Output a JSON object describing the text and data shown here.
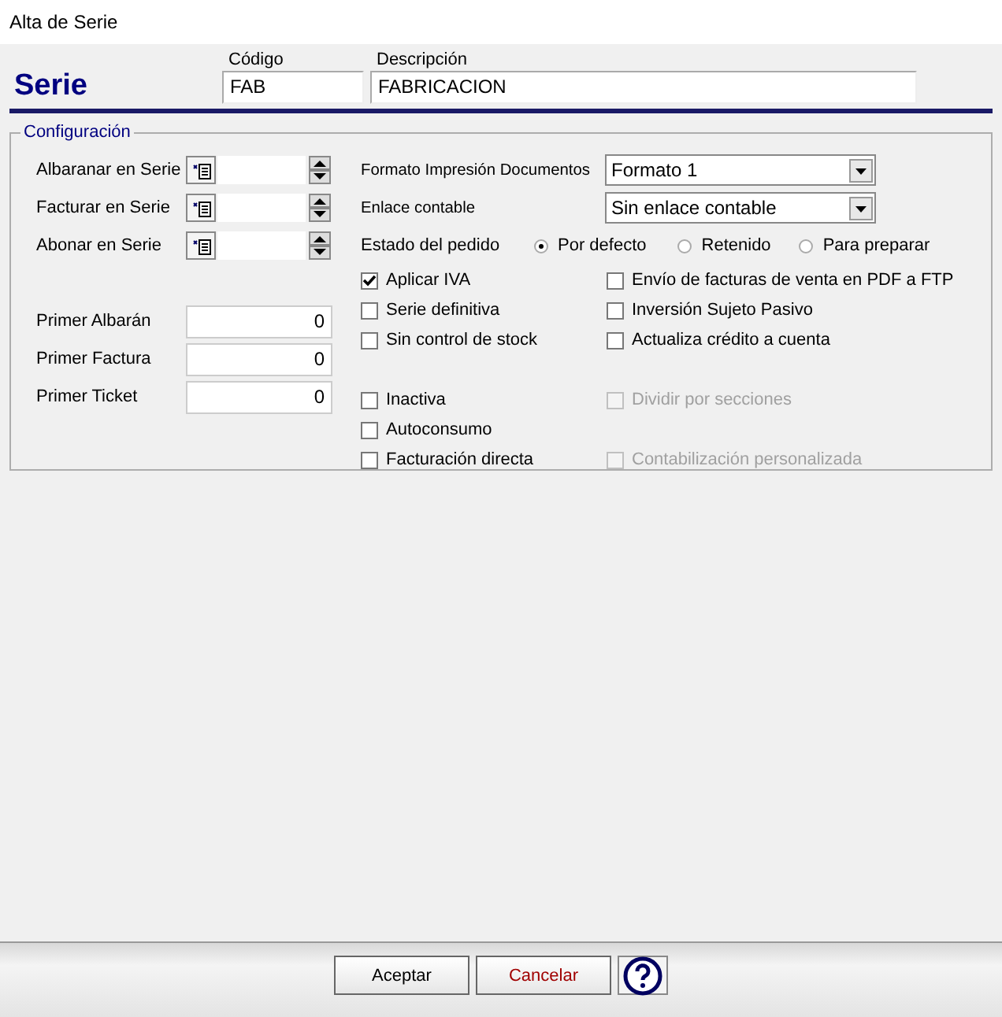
{
  "window": {
    "title": "Alta de Serie"
  },
  "header": {
    "title": "Serie",
    "fields": [
      {
        "label": "Código",
        "value": "FAB"
      },
      {
        "label": "Descripción",
        "value": "FABRICACION"
      }
    ]
  },
  "config": {
    "legend": "Configuración",
    "series_rows": [
      {
        "label": "Albaranar en Serie"
      },
      {
        "label": "Facturar en Serie"
      },
      {
        "label": "Abonar en Serie"
      }
    ],
    "counters": [
      {
        "label": "Primer Albarán",
        "value": "0"
      },
      {
        "label": "Primer Factura",
        "value": "0"
      },
      {
        "label": "Primer Ticket",
        "value": "0"
      }
    ],
    "selects": [
      {
        "label": "Formato Impresión Documentos",
        "value": "Formato 1"
      },
      {
        "label": "Enlace contable",
        "value": "Sin enlace contable"
      }
    ],
    "order_state": {
      "label": "Estado del pedido",
      "options": [
        {
          "label": "Por defecto",
          "selected": true
        },
        {
          "label": "Retenido",
          "selected": false
        },
        {
          "label": "Para preparar",
          "selected": false
        }
      ]
    },
    "checks_top": [
      {
        "label": "Aplicar IVA",
        "checked": true,
        "disabled": false
      },
      {
        "label": "Envío de facturas de venta en PDF a FTP",
        "checked": false,
        "disabled": false
      },
      {
        "label": "Serie definitiva",
        "checked": false,
        "disabled": false
      },
      {
        "label": "Inversión Sujeto Pasivo",
        "checked": false,
        "disabled": false
      },
      {
        "label": "Sin control de stock",
        "checked": false,
        "disabled": false
      },
      {
        "label": "Actualiza crédito a cuenta",
        "checked": false,
        "disabled": false
      }
    ],
    "checks_bottom_left": [
      {
        "label": "Inactiva",
        "checked": false,
        "disabled": false
      },
      {
        "label": "Autoconsumo",
        "checked": false,
        "disabled": false
      },
      {
        "label": "Facturación directa",
        "checked": false,
        "disabled": false
      }
    ],
    "checks_bottom_right": [
      {
        "label": "Dividir por secciones",
        "checked": false,
        "disabled": true
      },
      {
        "label": "Contabilización personalizada",
        "checked": false,
        "disabled": true
      }
    ]
  },
  "buttons": [
    {
      "label": "Aceptar",
      "kind": "primary"
    },
    {
      "label": "Cancelar",
      "kind": "cancel"
    }
  ]
}
